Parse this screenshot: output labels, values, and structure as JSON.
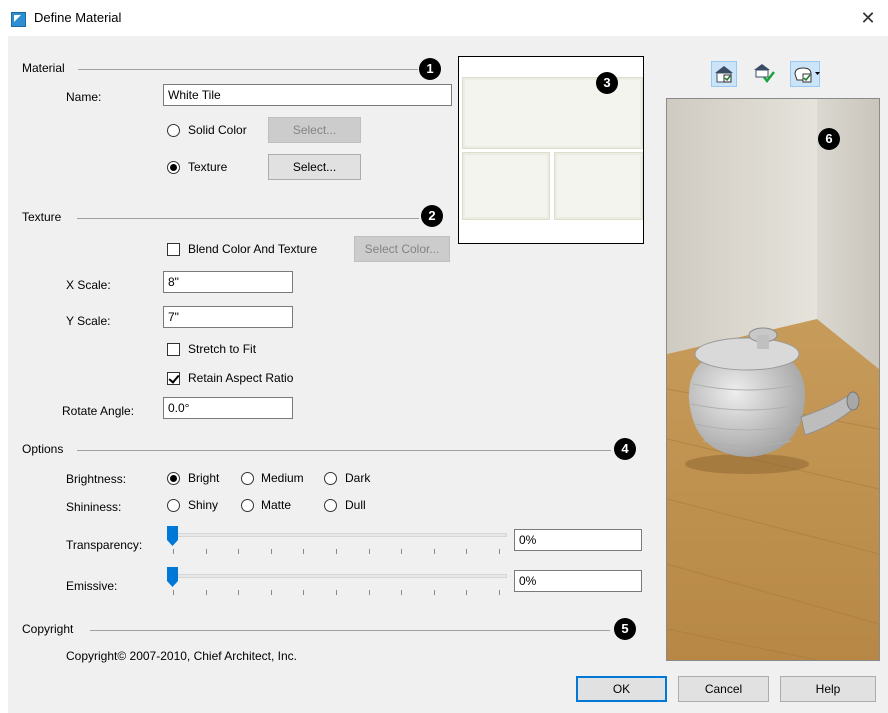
{
  "window": {
    "title": "Define Material",
    "close_glyph": "✕"
  },
  "material": {
    "section_label": "Material",
    "badge": "1",
    "name_label": "Name:",
    "name_value": "White Tile",
    "solid_color_label": "Solid Color",
    "solid_color_select": "Select...",
    "texture_label": "Texture",
    "texture_select": "Select...",
    "selected": "texture"
  },
  "preview": {
    "badge": "3"
  },
  "texture": {
    "section_label": "Texture",
    "badge": "2",
    "blend_label": "Blend Color And Texture",
    "blend_checked": false,
    "select_color": "Select Color...",
    "x_scale_label": "X Scale:",
    "x_scale_value": "8\"",
    "y_scale_label": "Y Scale:",
    "y_scale_value": "7\"",
    "stretch_label": "Stretch to Fit",
    "stretch_checked": false,
    "retain_label": "Retain Aspect Ratio",
    "retain_checked": true,
    "rotate_label": "Rotate Angle:",
    "rotate_value": "0.0°"
  },
  "options": {
    "section_label": "Options",
    "badge": "4",
    "brightness_label": "Brightness:",
    "brightness_options": [
      "Bright",
      "Medium",
      "Dark"
    ],
    "brightness_selected": "Bright",
    "shininess_label": "Shininess:",
    "shininess_options": [
      "Shiny",
      "Matte",
      "Dull"
    ],
    "shininess_selected": "none",
    "transparency_label": "Transparency:",
    "transparency_value": "0%",
    "transparency_level": 0,
    "emissive_label": "Emissive:",
    "emissive_value": "0%",
    "emissive_level": 0
  },
  "copyright": {
    "section_label": "Copyright",
    "badge": "5",
    "text": "Copyright© 2007-2010, Chief Architect, Inc."
  },
  "render_preview": {
    "badge": "6",
    "toolbar_icons": [
      "room-view-icon",
      "check-material-icon",
      "object-dropdown-icon"
    ]
  },
  "footer": {
    "ok": "OK",
    "cancel": "Cancel",
    "help": "Help"
  },
  "colors": {
    "accent": "#0078d7",
    "dialog_bg": "#f0f0f0",
    "floor": "#b98a4a",
    "wall": "#dcd9d2"
  }
}
